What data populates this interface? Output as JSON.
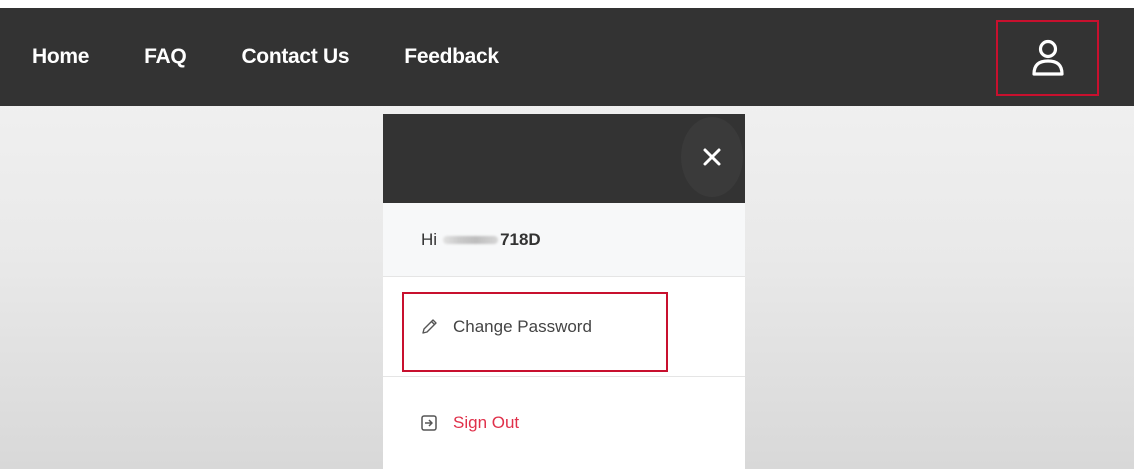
{
  "nav": {
    "links": [
      {
        "label": "Home"
      },
      {
        "label": "FAQ"
      },
      {
        "label": "Contact Us"
      },
      {
        "label": "Feedback"
      }
    ],
    "user_icon": "user-icon"
  },
  "panel": {
    "close_icon": "close-icon",
    "greeting_prefix": "Hi",
    "greeting_visible_suffix": "718D",
    "items": [
      {
        "label": "Change Password",
        "icon": "pencil-icon",
        "color": "#444444"
      },
      {
        "label": "Sign Out",
        "icon": "sign-out-icon",
        "color": "#e0304a"
      }
    ]
  },
  "colors": {
    "navbar_bg": "#333333",
    "highlight": "#c8102e",
    "signout_text": "#e0304a"
  }
}
